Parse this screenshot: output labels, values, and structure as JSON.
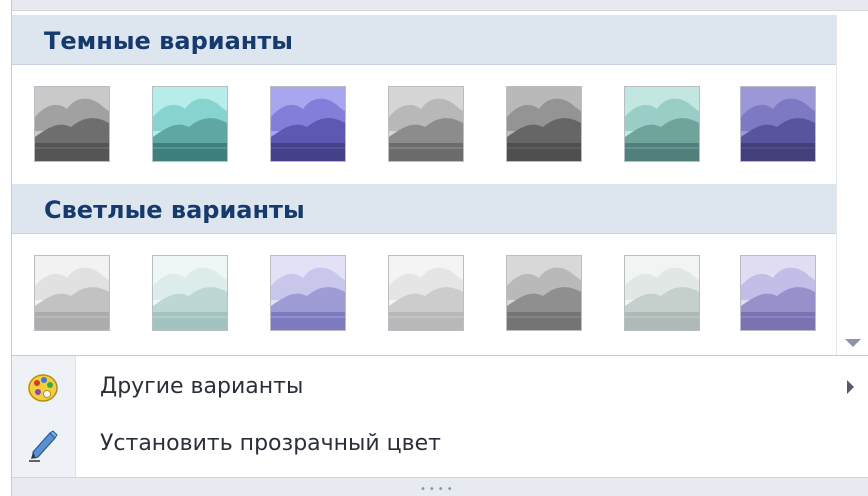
{
  "dark_section": {
    "title": "Темные варианты",
    "swatches": [
      {
        "name": "grayscale",
        "colors": {
          "sky": "#c9c9c9",
          "cloud": "#9a9a9a",
          "hill": "#6e6e6e",
          "water": "#555555"
        }
      },
      {
        "name": "teal",
        "colors": {
          "sky": "#b6ecea",
          "cloud": "#7fcfcb",
          "hill": "#5ea7a3",
          "water": "#3f807c"
        }
      },
      {
        "name": "blue-violet",
        "colors": {
          "sky": "#a9a6f0",
          "cloud": "#7b77d6",
          "hill": "#5d59b2",
          "water": "#45428a"
        }
      },
      {
        "name": "light-gray",
        "colors": {
          "sky": "#d6d6d6",
          "cloud": "#b3b3b3",
          "hill": "#8c8c8c",
          "water": "#6c6c6c"
        }
      },
      {
        "name": "dark-gray",
        "colors": {
          "sky": "#b9b9b9",
          "cloud": "#8d8d8d",
          "hill": "#666666",
          "water": "#4f4f4f"
        }
      },
      {
        "name": "sea-green",
        "colors": {
          "sky": "#c2e7e0",
          "cloud": "#93c8bf",
          "hill": "#6ea49a",
          "water": "#51807a"
        }
      },
      {
        "name": "violet",
        "colors": {
          "sky": "#9c98d8",
          "cloud": "#7873bf",
          "hill": "#58549d",
          "water": "#433f7b"
        }
      }
    ]
  },
  "light_section": {
    "title": "Светлые варианты",
    "swatches": [
      {
        "name": "light-grayscale",
        "colors": {
          "sky": "#f2f2f2",
          "cloud": "#dedede",
          "hill": "#c2c2c2",
          "water": "#acacac"
        }
      },
      {
        "name": "light-teal",
        "colors": {
          "sky": "#eef7f6",
          "cloud": "#d7eae8",
          "hill": "#bdd7d4",
          "water": "#a3c3c0"
        }
      },
      {
        "name": "light-violet",
        "colors": {
          "sky": "#e3e1f6",
          "cloud": "#c4c1ea",
          "hill": "#9f9bd5",
          "water": "#7e7abf"
        }
      },
      {
        "name": "pale-gray",
        "colors": {
          "sky": "#f4f4f4",
          "cloud": "#e2e2e2",
          "hill": "#cccccc",
          "water": "#b8b8b8"
        }
      },
      {
        "name": "mid-gray",
        "colors": {
          "sky": "#d8d8d8",
          "cloud": "#b4b4b4",
          "hill": "#8f8f8f",
          "water": "#747474"
        }
      },
      {
        "name": "pale-green-gray",
        "colors": {
          "sky": "#f1f4f3",
          "cloud": "#dde4e2",
          "hill": "#c5cfcc",
          "water": "#adbab7"
        }
      },
      {
        "name": "lavender",
        "colors": {
          "sky": "#e1def3",
          "cloud": "#bdb8e4",
          "hill": "#9791cb",
          "water": "#7a73b3"
        }
      }
    ]
  },
  "menu": {
    "more_variants": {
      "label": "Другие варианты",
      "icon": "color-palette-icon"
    },
    "set_transparent": {
      "label": "Установить прозрачный цвет",
      "icon": "pen-icon"
    }
  },
  "colors": {
    "header_text": "#163a6e",
    "header_bg": "#dde6ee"
  }
}
